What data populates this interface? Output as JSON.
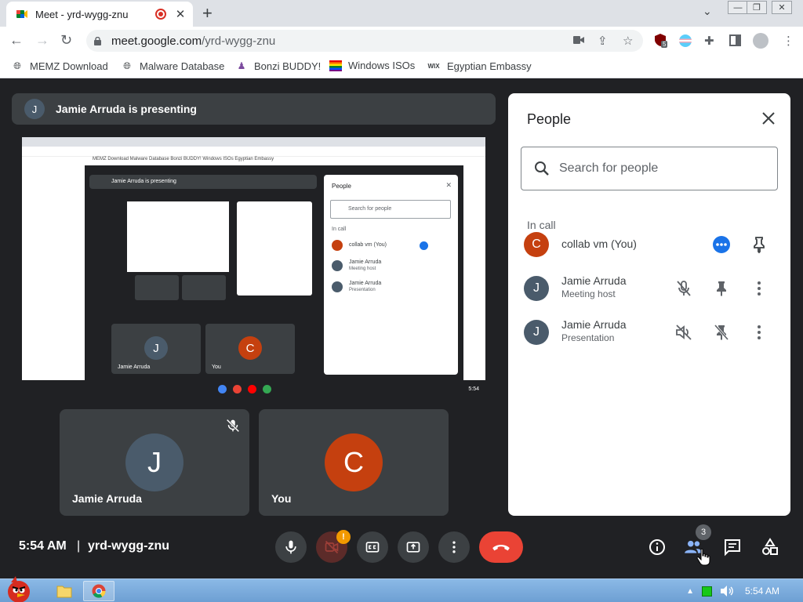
{
  "browser": {
    "tab_title": "Meet - yrd-wygg-znu",
    "new_tab": "+",
    "url_host": "meet.google.com",
    "url_path": "/yrd-wygg-znu",
    "extensions_badge": "5"
  },
  "bookmarks": [
    {
      "label": "MEMZ Download"
    },
    {
      "label": "Malware Database"
    },
    {
      "label": "Bonzi BUDDY!"
    },
    {
      "label": "Windows ISOs"
    },
    {
      "label": "Egyptian Embassy",
      "icon_text": "WIX"
    }
  ],
  "meet": {
    "presenting_initial": "J",
    "presenting_text": "Jamie Arruda is presenting",
    "tiles": [
      {
        "initial": "J",
        "name": "Jamie Arruda",
        "color": "#4a5b6b"
      },
      {
        "initial": "C",
        "name": "You",
        "color": "#c5400f"
      }
    ],
    "time": "5:54 AM",
    "separator": "|",
    "meeting_code": "yrd-wygg-znu",
    "camera_warning": "!",
    "participant_count": "3"
  },
  "people_panel": {
    "title": "People",
    "search_placeholder": "Search for people",
    "section": "In call",
    "participants": [
      {
        "initial": "C",
        "name": "collab vm (You)",
        "role": "",
        "color": "#c5400f"
      },
      {
        "initial": "J",
        "name": "Jamie Arruda",
        "role": "Meeting host",
        "color": "#4a5b6b"
      },
      {
        "initial": "J",
        "name": "Jamie Arruda",
        "role": "Presentation",
        "color": "#4a5b6b"
      }
    ]
  },
  "shared_screen": {
    "presenting_text": "Jamie Arruda is presenting",
    "panel_title": "People",
    "panel_search": "Search for people",
    "panel_section": "In call",
    "panel_rows": [
      {
        "name": "collab vm (You)",
        "role": ""
      },
      {
        "name": "Jamie Arruda",
        "role": "Meeting host"
      },
      {
        "name": "Jamie Arruda",
        "role": "Presentation"
      }
    ],
    "tile_names": [
      "Jamie Arruda",
      "You"
    ],
    "tile_initials": [
      "J",
      "C"
    ],
    "bookmarks_text": "MEMZ Download   Malware Database   Bonzi BUDDY!   Windows ISOs   Egyptian Embassy",
    "clock": "5:54"
  },
  "taskbar": {
    "clock": "5:54 AM"
  },
  "colors": {
    "meet_bg": "#202124",
    "tile_bg": "#3c4043",
    "end_call": "#ea4335",
    "accent_blue": "#1a73e8",
    "people_active": "#8ab4f8"
  }
}
